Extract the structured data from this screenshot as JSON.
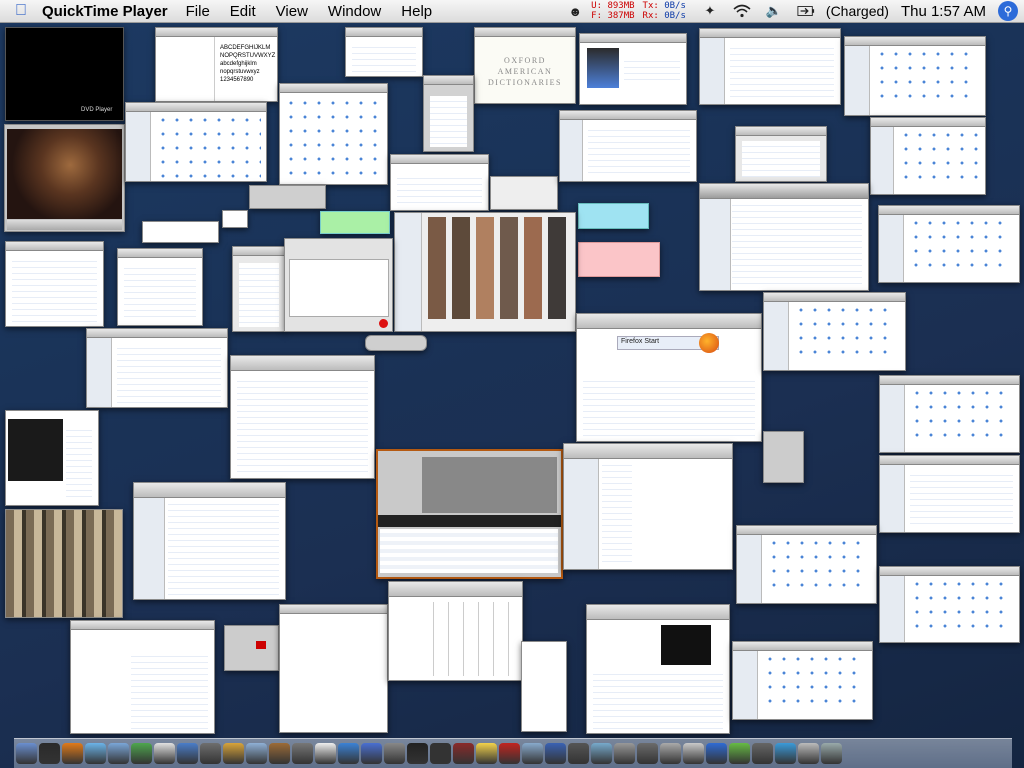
{
  "menubar": {
    "app_name": "QuickTime Player",
    "menus": [
      "File",
      "Edit",
      "View",
      "Window",
      "Help"
    ],
    "net": {
      "u": "U:",
      "u_val": "893MB",
      "f": "F:",
      "f_val": "387MB",
      "tx": "Tx:",
      "tx_val": "0B/s",
      "rx": "Rx:",
      "rx_val": "0B/s"
    },
    "battery": "(Charged)",
    "clock": "Thu 1:57 AM"
  },
  "windows": {
    "dvd_label": "DVD Player",
    "font_sample": [
      "ABCDEFGHIJKLM",
      "NOPQRSTUVWXYZ",
      "abcdefghijklm",
      "nopqrstuvwxyz",
      "1234567890"
    ],
    "dictionary": [
      "OXFORD",
      "AMERICAN",
      "DICTIONARIES"
    ],
    "firefox_title": "Firefox Start"
  },
  "colors": {
    "desktop": "#1b3358",
    "menubar": "#e8e8e8",
    "accent": "#2c6bd9",
    "net_up": "#c00000",
    "net_down": "#0c3aa8"
  },
  "dock": {
    "icons": [
      "finder-icon",
      "dashboard-icon",
      "firefox-icon",
      "itunes-icon",
      "mail-icon",
      "ichat-icon",
      "ical-icon",
      "iphoto-icon",
      "imovie-icon",
      "garageband-icon",
      "preview-icon",
      "address-book-icon",
      "calculator-icon",
      "textedit-icon",
      "safari-icon",
      "quicktime-icon",
      "system-preferences-icon",
      "terminal-icon",
      "dvd-icon",
      "photo-booth-icon",
      "stickies-icon",
      "acrobat-icon",
      "network-icon",
      "keynote-icon",
      "activity-monitor-icon",
      "grapher-icon",
      "console-icon",
      "automator-icon",
      "disk-utility-icon",
      "font-book-icon",
      "help-icon",
      "directory-icon",
      "script-icon",
      "iweb-icon",
      "downloads-icon",
      "trash-icon"
    ]
  }
}
